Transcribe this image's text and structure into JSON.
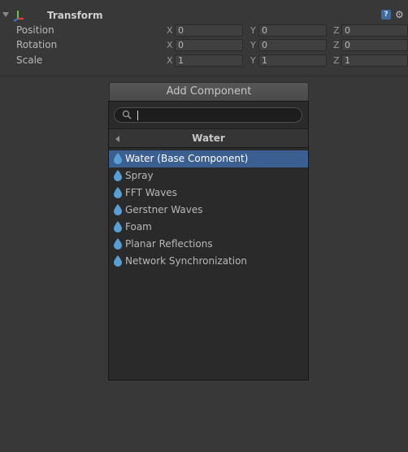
{
  "transform": {
    "title": "Transform",
    "help_glyph": "?",
    "gear_glyph": "⚙",
    "rows": [
      {
        "label": "Position",
        "x": "0",
        "y": "0",
        "z": "0"
      },
      {
        "label": "Rotation",
        "x": "0",
        "y": "0",
        "z": "0"
      },
      {
        "label": "Scale",
        "x": "1",
        "y": "1",
        "z": "1"
      }
    ],
    "axis_labels": {
      "x": "X",
      "y": "Y",
      "z": "Z"
    }
  },
  "add_component": {
    "button_label": "Add Component",
    "search_value": "",
    "category_title": "Water",
    "items": [
      {
        "label": "Water (Base Component)",
        "icon": "water-drop-icon",
        "selected": true
      },
      {
        "label": "Spray",
        "icon": "water-drop-icon",
        "selected": false
      },
      {
        "label": "FFT Waves",
        "icon": "water-drop-icon",
        "selected": false
      },
      {
        "label": "Gerstner Waves",
        "icon": "water-drop-icon",
        "selected": false
      },
      {
        "label": "Foam",
        "icon": "water-drop-icon",
        "selected": false
      },
      {
        "label": "Planar Reflections",
        "icon": "water-drop-icon",
        "selected": false
      },
      {
        "label": "Network Synchronization",
        "icon": "water-drop-icon",
        "selected": false
      }
    ]
  },
  "colors": {
    "background": "#383838",
    "popup_background": "#2a2a2a",
    "selection": "#3c5f91",
    "drop_icon": "#5a9fd4"
  }
}
